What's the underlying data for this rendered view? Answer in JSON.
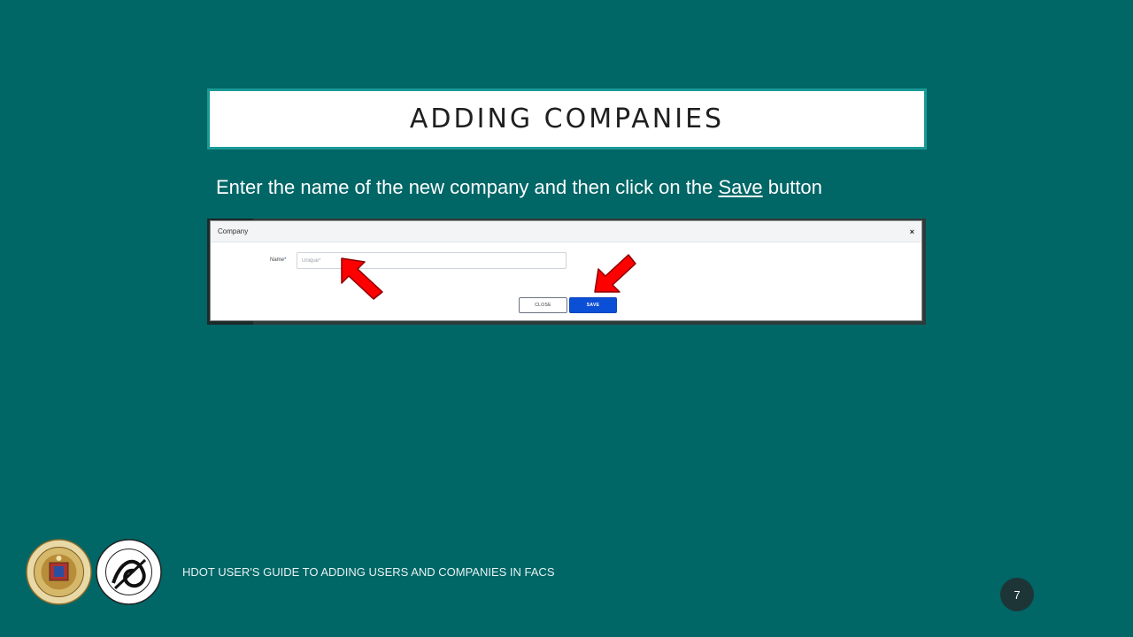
{
  "slide": {
    "title": "ADDING COMPANIES",
    "instruction_pre": "Enter the name of the new company and then click on the ",
    "instruction_link": "Save",
    "instruction_post": " button"
  },
  "modal": {
    "title": "Company",
    "close_symbol": "×",
    "name_label": "Name",
    "required_marker": "*",
    "name_placeholder": "Unique*",
    "close_button": "CLOSE",
    "save_button": "SAVE"
  },
  "footer": {
    "text": "HDOT USER'S GUIDE TO  ADDING USERS AND COMPANIES IN FACS",
    "page_number": "7"
  },
  "colors": {
    "background": "#006666",
    "title_border": "#1a9a96",
    "save_button": "#0b4fd6",
    "arrow": "#ff0000"
  },
  "icons": [
    "state-of-hawaii-seal-icon",
    "hdot-logo-icon",
    "red-arrow-icon"
  ]
}
